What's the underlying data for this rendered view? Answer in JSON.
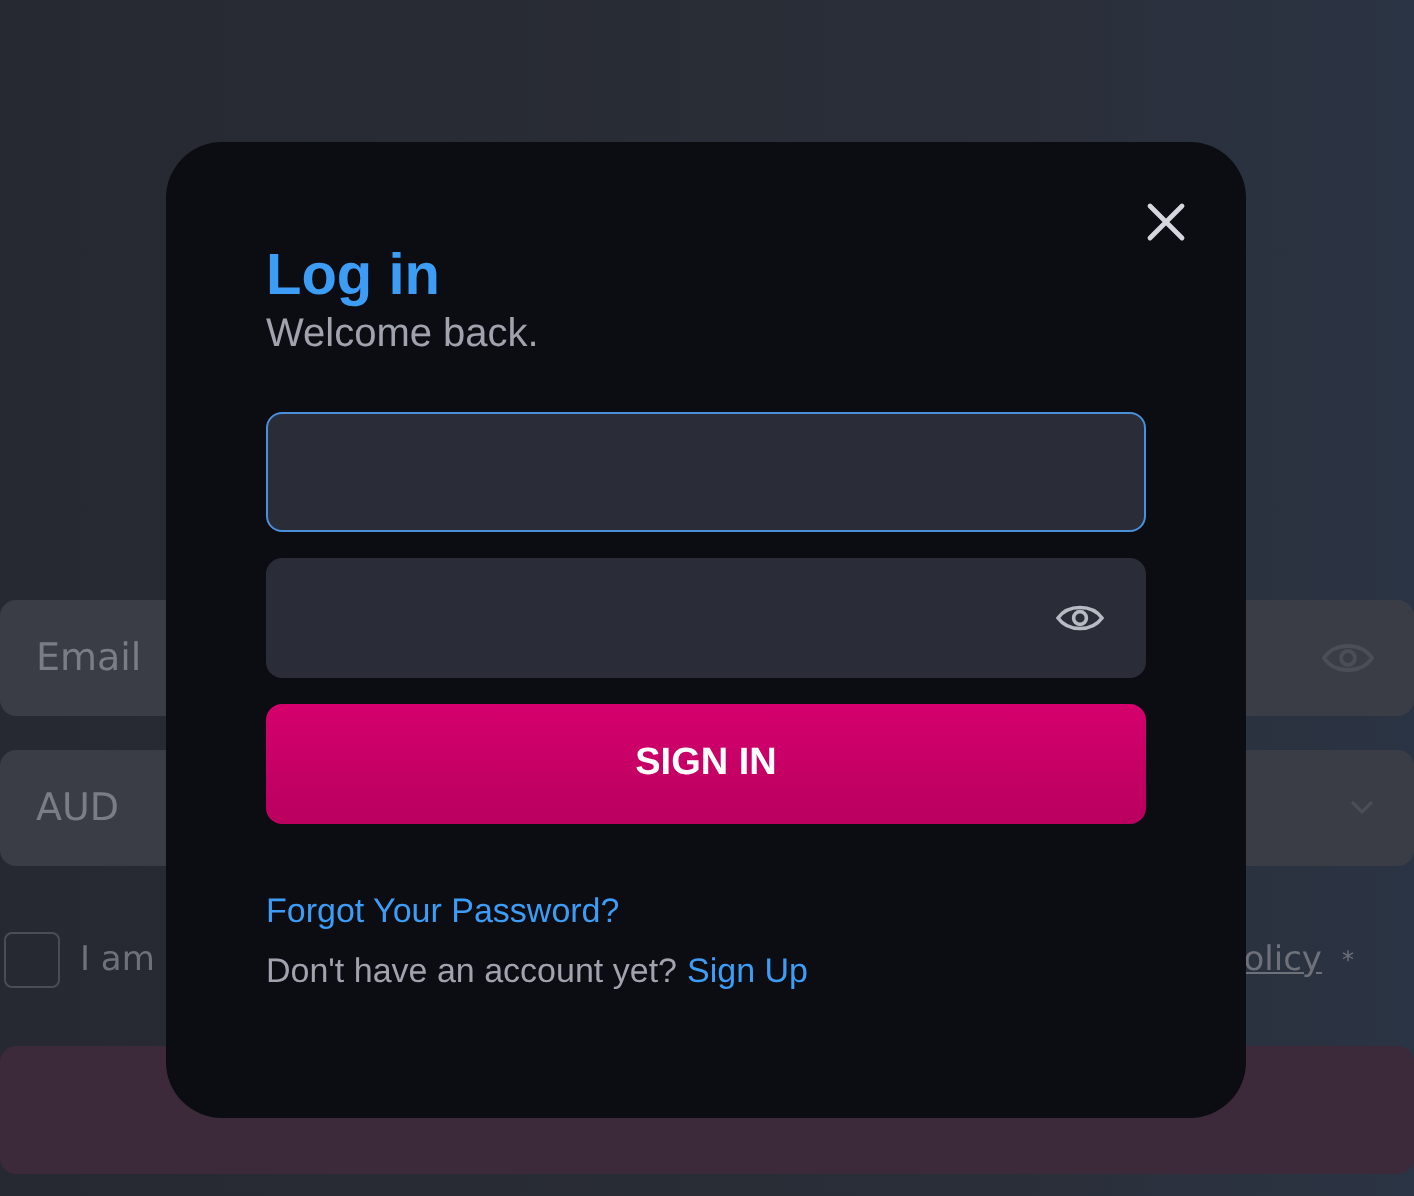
{
  "background": {
    "email": {
      "placeholder": "Email"
    },
    "currency": {
      "value": "AUD"
    },
    "terms": {
      "checked": false,
      "label": "I am",
      "link": "olicy",
      "required_mark": "*"
    }
  },
  "modal": {
    "title": "Log in",
    "subtitle": "Welcome back.",
    "fields": [
      {
        "kind": "text",
        "focused": true
      },
      {
        "kind": "password",
        "focused": false
      }
    ],
    "submit": "SIGN IN",
    "forgot_link": "Forgot Your Password?",
    "signup_prompt": "Don't have an account yet?",
    "signup_link": "Sign Up"
  }
}
